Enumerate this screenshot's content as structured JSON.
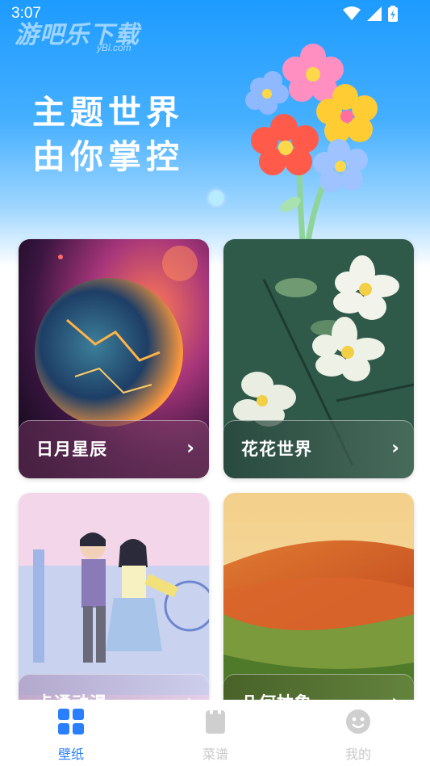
{
  "status_bar": {
    "time": "3:07"
  },
  "watermark": {
    "text": "游吧乐下载",
    "sub": "yBl.com"
  },
  "hero": {
    "title_line1": "主题世界",
    "title_line2": "由你掌控"
  },
  "cards": [
    {
      "label": "日月星辰",
      "arrow": "›"
    },
    {
      "label": "花花世界",
      "arrow": "›"
    },
    {
      "label": "卡通动漫",
      "arrow": "›"
    },
    {
      "label": "几何抽象",
      "arrow": "›"
    }
  ],
  "nav": [
    {
      "label": "壁纸",
      "icon": "wallpaper-grid-icon",
      "active": true
    },
    {
      "label": "菜谱",
      "icon": "recipe-icon",
      "active": false
    },
    {
      "label": "我的",
      "icon": "profile-face-icon",
      "active": false
    }
  ],
  "colors": {
    "accent": "#2a7fff",
    "inactive": "#c9c9c9",
    "hero_blue": "#1d9bff"
  }
}
